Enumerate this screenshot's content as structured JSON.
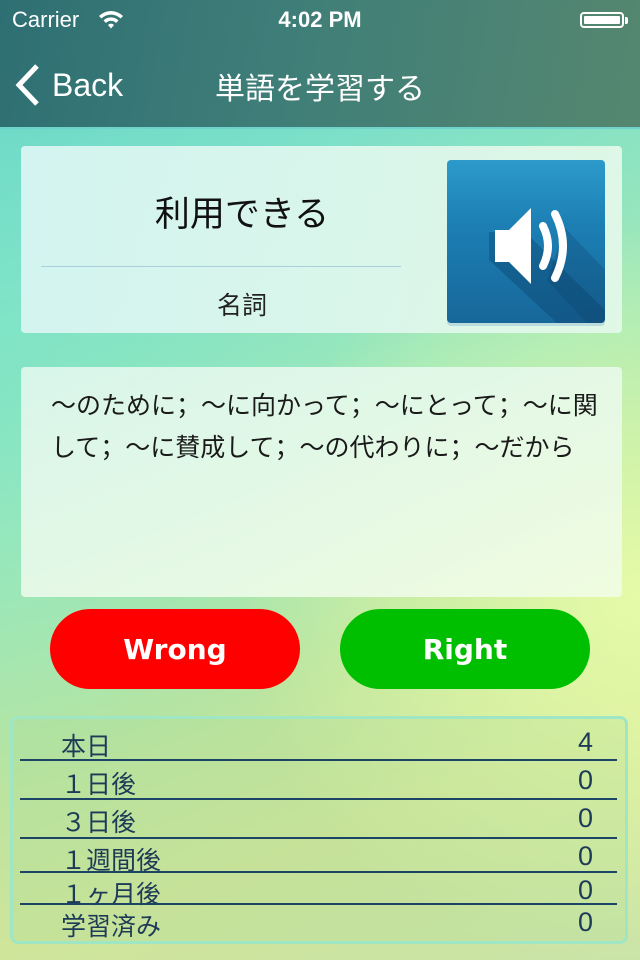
{
  "status_bar": {
    "carrier": "Carrier",
    "time": "4:02 PM",
    "wifi_icon": "wifi-icon",
    "battery_icon": "battery-full-icon"
  },
  "nav": {
    "back_label": "Back",
    "title": "単語を学習する"
  },
  "word_card": {
    "word": "利用できる",
    "part_of_speech": "名詞",
    "speaker_icon": "speaker-volume-icon"
  },
  "definition": {
    "text": "～のために；～に向かって；～にとって；～に関して；～に賛成して；～の代わりに；～だから"
  },
  "actions": {
    "wrong_label": "Wrong",
    "right_label": "Right",
    "wrong_color": "#ff0000",
    "right_color": "#00bf00"
  },
  "stats": {
    "rows": [
      {
        "label": "本日",
        "value": "4"
      },
      {
        "label": "１日後",
        "value": "0"
      },
      {
        "label": "３日後",
        "value": "0"
      },
      {
        "label": "１週間後",
        "value": "0"
      },
      {
        "label": "１ヶ月後",
        "value": "0"
      },
      {
        "label": "学習済み",
        "value": "0"
      }
    ]
  }
}
